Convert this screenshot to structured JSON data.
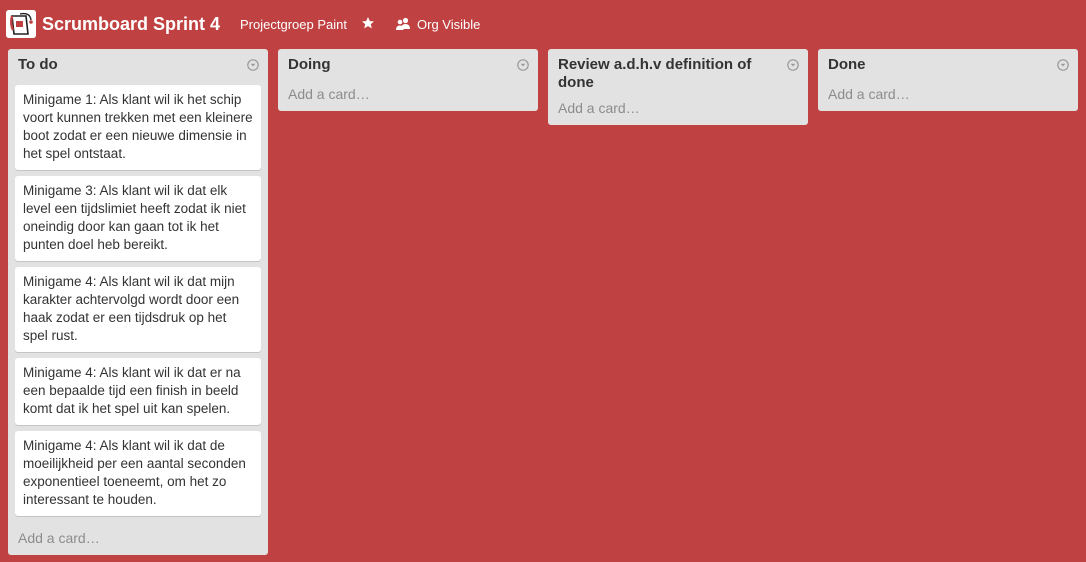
{
  "board": {
    "title": "Scrumboard Sprint 4",
    "organization": "Projectgroep Paint",
    "visibility": "Org Visible",
    "background_color": "#c04142"
  },
  "icons": {
    "logo": "paint-bucket-logo",
    "star": "star-icon",
    "visibility": "people-icon",
    "list_menu": "chevron-down-circle-icon"
  },
  "lists": [
    {
      "title": "To do",
      "add_card_label": "Add a card…",
      "cards": [
        "Minigame 1: Als klant wil ik het schip voort kunnen trekken met een kleinere boot zodat er een nieuwe dimensie in het spel ontstaat.",
        "Minigame 3: Als klant wil ik dat elk level een tijdslimiet heeft zodat ik niet oneindig door kan gaan tot ik het punten doel heb bereikt.",
        "Minigame 4: Als klant wil ik dat mijn karakter achtervolgd wordt door een haak zodat er een tijdsdruk op het spel rust.",
        "Minigame 4: Als klant wil ik dat er na een bepaalde tijd een finish in beeld komt dat ik het spel uit kan spelen.",
        "Minigame 4: Als klant wil ik dat de moeilijkheid per een aantal seconden exponentieel toeneemt, om het zo interessant te houden."
      ]
    },
    {
      "title": "Doing",
      "add_card_label": "Add a card…",
      "cards": []
    },
    {
      "title": "Review a.d.h.v definition of done",
      "add_card_label": "Add a card…",
      "cards": []
    },
    {
      "title": "Done",
      "add_card_label": "Add a card…",
      "cards": []
    }
  ]
}
